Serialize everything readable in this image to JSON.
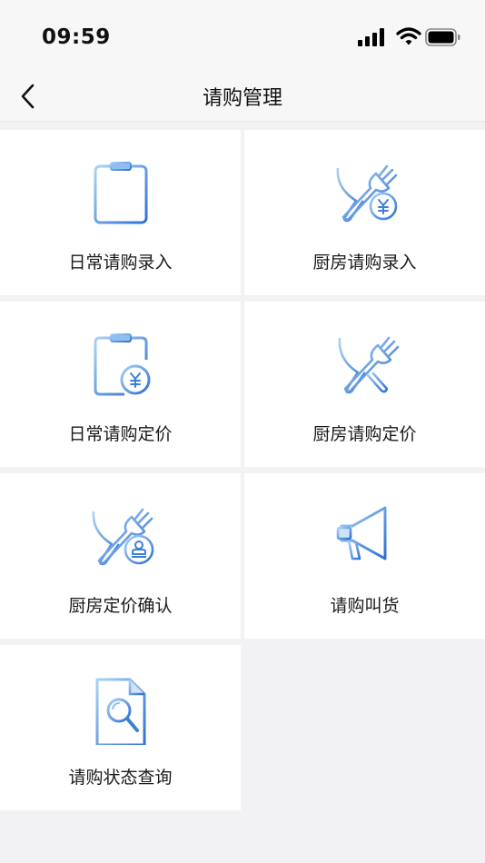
{
  "status_bar": {
    "time": "09:59",
    "icons": [
      "signal-icon",
      "wifi-icon",
      "battery-icon"
    ]
  },
  "nav": {
    "title": "请购管理",
    "back_icon": "chevron-left-icon"
  },
  "menu": {
    "items": [
      {
        "label": "日常请购录入",
        "icon": "clipboard-icon"
      },
      {
        "label": "厨房请购录入",
        "icon": "utensils-yen-icon"
      },
      {
        "label": "日常请购定价",
        "icon": "clipboard-yen-icon"
      },
      {
        "label": "厨房请购定价",
        "icon": "utensils-icon"
      },
      {
        "label": "厨房定价确认",
        "icon": "utensils-stamp-icon"
      },
      {
        "label": "请购叫货",
        "icon": "megaphone-icon"
      },
      {
        "label": "请购状态查询",
        "icon": "document-search-icon"
      }
    ]
  },
  "colors": {
    "icon_light": "#9cc7f2",
    "icon_dark": "#3d7fd6",
    "background": "#f2f2f5",
    "tile": "#ffffff"
  }
}
